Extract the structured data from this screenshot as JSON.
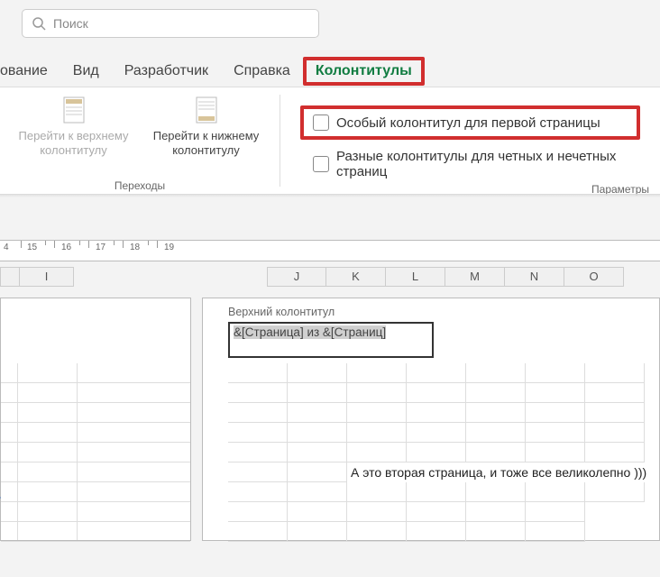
{
  "search": {
    "placeholder": "Поиск"
  },
  "tabs": {
    "t0": "ование",
    "t1": "Вид",
    "t2": "Разработчик",
    "t3": "Справка",
    "t4": "Колонтитулы"
  },
  "ribbon": {
    "nav_top": "Перейти к верхнему колонтитулу",
    "nav_bottom": "Перейти к нижнему колонтитулу",
    "group_nav": "Переходы",
    "opt_first": "Особый колонтитул для первой страницы",
    "opt_oddeven": "Разные колонтитулы для четных и нечетных страниц",
    "group_opts": "Параметры"
  },
  "ruler": {
    "labels": [
      "4",
      "15",
      "16",
      "17",
      "18",
      "19"
    ]
  },
  "cols": {
    "I": "I",
    "J": "J",
    "K": "K",
    "L": "L",
    "M": "M",
    "N": "N",
    "O": "O"
  },
  "header": {
    "label": "Верхний колонтитул",
    "code": "&[Страница] из &[Страниц]"
  },
  "cell_text": "А это вторая страница, и тоже все великолепно )))"
}
